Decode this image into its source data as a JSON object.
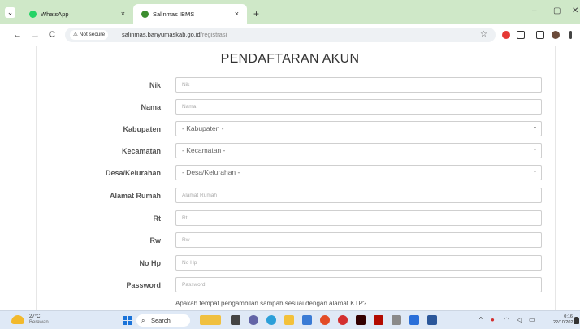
{
  "browser": {
    "tabs": [
      {
        "label": "WhatsApp",
        "close": "×",
        "active": false,
        "favicon_color": "#25d366"
      },
      {
        "label": "Salinmas IBMS",
        "close": "×",
        "active": true,
        "favicon_color": "#3c8d2f"
      }
    ],
    "new_tab": "+",
    "minimize": "–",
    "restore": "▢",
    "close": "✕",
    "back": "←",
    "forward": "→",
    "reload": "C",
    "security_label": "⚠ Not secure",
    "url_host": "salinmas.banyumaskab.go.id",
    "url_path": "/registrasi",
    "bookmark": "☆"
  },
  "page": {
    "title": "PENDAFTARAN AKUN",
    "fields": [
      {
        "label": "Nik",
        "placeholder": "Nik",
        "type": "input"
      },
      {
        "label": "Nama",
        "placeholder": "Nama",
        "type": "input"
      },
      {
        "label": "Kabupaten",
        "value": "- Kabupaten -",
        "type": "select"
      },
      {
        "label": "Kecamatan",
        "value": "- Kecamatan -",
        "type": "select"
      },
      {
        "label": "Desa/Kelurahan",
        "value": "- Desa/Kelurahan -",
        "type": "select"
      },
      {
        "label": "Alamat Rumah",
        "placeholder": "Alamat Rumah",
        "type": "input"
      },
      {
        "label": "Rt",
        "placeholder": "Rt",
        "type": "input"
      },
      {
        "label": "Rw",
        "placeholder": "Rw",
        "type": "input"
      },
      {
        "label": "No Hp",
        "placeholder": "No Hp",
        "type": "input"
      },
      {
        "label": "Password",
        "placeholder": "Password",
        "type": "password"
      }
    ],
    "question": "Apakah tempat pengambilan sampah sesuai dengan alamat KTP?"
  },
  "taskbar": {
    "weather_temp": "27°C",
    "weather_desc": "Berawan",
    "search_label": "Search",
    "time": "0:16",
    "date": "22/10/2023"
  },
  "colors": {
    "tab_strip": "#cfe8c8",
    "taskbar": "#dfe9f6",
    "start_blue": "#1a73d9"
  }
}
